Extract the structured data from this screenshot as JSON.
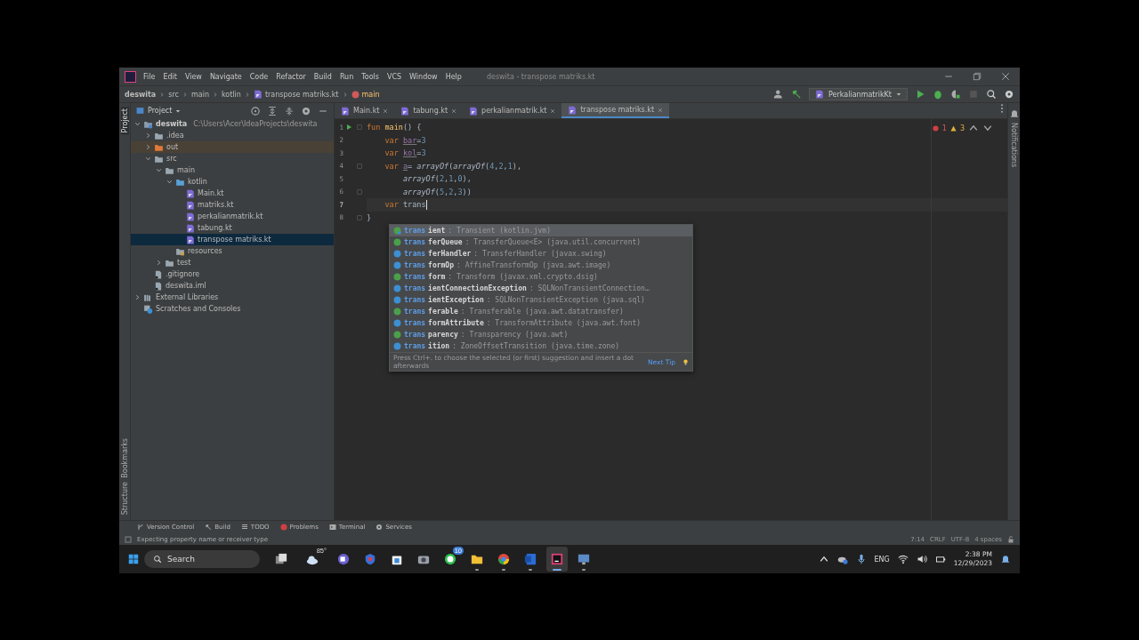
{
  "window": {
    "title": "deswita - transpose matriks.kt",
    "menu": [
      "File",
      "Edit",
      "View",
      "Navigate",
      "Code",
      "Refactor",
      "Build",
      "Run",
      "Tools",
      "VCS",
      "Window",
      "Help"
    ]
  },
  "breadcrumbs": [
    {
      "label": "deswita",
      "kind": "project"
    },
    {
      "label": "src",
      "kind": "plain"
    },
    {
      "label": "main",
      "kind": "plain"
    },
    {
      "label": "kotlin",
      "kind": "plain"
    },
    {
      "label": "transpose matriks.kt",
      "kind": "file"
    },
    {
      "label": "main",
      "kind": "function"
    }
  ],
  "run_config": {
    "label": "PerkalianmatrikKt"
  },
  "side_strip": {
    "top": [
      {
        "label": "Project",
        "selected": true
      }
    ],
    "bottom": [
      {
        "label": "Bookmarks",
        "selected": false
      },
      {
        "label": "Structure",
        "selected": false
      }
    ],
    "right": [
      {
        "label": "Notifications",
        "selected": false
      }
    ]
  },
  "project_panel": {
    "title": "Project",
    "tree": [
      {
        "label": "deswita",
        "kind": "module",
        "hint": "C:\\Users\\Acer\\IdeaProjects\\deswita",
        "expanded": true,
        "selected": false,
        "children": [
          {
            "label": ".idea",
            "kind": "folder",
            "expanded": false,
            "selected": false
          },
          {
            "label": "out",
            "kind": "excluded",
            "expanded": false,
            "selected": false
          },
          {
            "label": "src",
            "kind": "folder",
            "expanded": true,
            "selected": false,
            "children": [
              {
                "label": "main",
                "kind": "folder",
                "expanded": true,
                "selected": false,
                "children": [
                  {
                    "label": "kotlin",
                    "kind": "source",
                    "expanded": true,
                    "selected": false,
                    "children": [
                      {
                        "label": "Main.kt",
                        "kind": "kotlin",
                        "selected": false
                      },
                      {
                        "label": "matriks.kt",
                        "kind": "kotlin",
                        "selected": false
                      },
                      {
                        "label": "perkalianmatrik.kt",
                        "kind": "kotlin",
                        "selected": false
                      },
                      {
                        "label": "tabung.kt",
                        "kind": "kotlin",
                        "selected": false
                      },
                      {
                        "label": "transpose matriks.kt",
                        "kind": "kotlin",
                        "selected": true
                      }
                    ]
                  },
                  {
                    "label": "resources",
                    "kind": "resources",
                    "selected": false
                  }
                ]
              },
              {
                "label": "test",
                "kind": "folder",
                "expanded": false,
                "selected": false
              }
            ]
          },
          {
            "label": ".gitignore",
            "kind": "textfile",
            "selected": false
          },
          {
            "label": "deswita.iml",
            "kind": "textfile",
            "selected": false
          }
        ]
      },
      {
        "label": "External Libraries",
        "kind": "libraries",
        "expanded": false,
        "selected": false
      },
      {
        "label": "Scratches and Consoles",
        "kind": "scratches",
        "selected": false
      }
    ]
  },
  "tabs": [
    {
      "label": "Main.kt",
      "selected": false
    },
    {
      "label": "tabung.kt",
      "selected": false
    },
    {
      "label": "perkalianmatrik.kt",
      "selected": false
    },
    {
      "label": "transpose matriks.kt",
      "selected": true
    }
  ],
  "editor": {
    "inspections": {
      "errors": "1",
      "warnings": "3"
    },
    "lines": [
      {
        "number": "1",
        "run": true,
        "fold": true,
        "current": false,
        "tokens": [
          {
            "kind": "keyword",
            "text": "fun "
          },
          {
            "kind": "function",
            "text": "main"
          },
          {
            "kind": "plain",
            "text": "() {"
          }
        ]
      },
      {
        "number": "2",
        "run": false,
        "fold": false,
        "current": false,
        "tokens": [
          {
            "kind": "keyword",
            "text": "    var "
          },
          {
            "kind": "unused",
            "text": "bar"
          },
          {
            "kind": "plain",
            "text": "="
          },
          {
            "kind": "number",
            "text": "3"
          }
        ]
      },
      {
        "number": "3",
        "run": false,
        "fold": false,
        "current": false,
        "tokens": [
          {
            "kind": "keyword",
            "text": "    var "
          },
          {
            "kind": "unused",
            "text": "kol"
          },
          {
            "kind": "plain",
            "text": "="
          },
          {
            "kind": "number",
            "text": "3"
          }
        ]
      },
      {
        "number": "4",
        "run": false,
        "fold": true,
        "current": false,
        "tokens": [
          {
            "kind": "keyword",
            "text": "    var "
          },
          {
            "kind": "unused",
            "text": "a"
          },
          {
            "kind": "plain",
            "text": "= "
          },
          {
            "kind": "call",
            "text": "arrayOf"
          },
          {
            "kind": "plain",
            "text": "("
          },
          {
            "kind": "call",
            "text": "arrayOf"
          },
          {
            "kind": "plain",
            "text": "("
          },
          {
            "kind": "number",
            "text": "4"
          },
          {
            "kind": "plain",
            "text": ","
          },
          {
            "kind": "number",
            "text": "2"
          },
          {
            "kind": "plain",
            "text": ","
          },
          {
            "kind": "number",
            "text": "1"
          },
          {
            "kind": "plain",
            "text": "),"
          }
        ]
      },
      {
        "number": "5",
        "run": false,
        "fold": false,
        "current": false,
        "tokens": [
          {
            "kind": "call",
            "text": "        arrayOf"
          },
          {
            "kind": "plain",
            "text": "("
          },
          {
            "kind": "number",
            "text": "2"
          },
          {
            "kind": "plain",
            "text": ","
          },
          {
            "kind": "number",
            "text": "1"
          },
          {
            "kind": "plain",
            "text": ","
          },
          {
            "kind": "number",
            "text": "0"
          },
          {
            "kind": "plain",
            "text": "),"
          }
        ]
      },
      {
        "number": "6",
        "run": false,
        "fold": true,
        "current": false,
        "tokens": [
          {
            "kind": "call",
            "text": "        arrayOf"
          },
          {
            "kind": "plain",
            "text": "("
          },
          {
            "kind": "number",
            "text": "5"
          },
          {
            "kind": "plain",
            "text": ","
          },
          {
            "kind": "number",
            "text": "2"
          },
          {
            "kind": "plain",
            "text": ","
          },
          {
            "kind": "number",
            "text": "3"
          },
          {
            "kind": "plain",
            "text": "))"
          }
        ]
      },
      {
        "number": "7",
        "run": false,
        "fold": false,
        "current": true,
        "tokens": [
          {
            "kind": "keyword",
            "text": "    var "
          },
          {
            "kind": "plain",
            "text": "trans"
          }
        ]
      },
      {
        "number": "8",
        "run": false,
        "fold": true,
        "current": false,
        "tokens": [
          {
            "kind": "plain",
            "text": "}"
          }
        ]
      }
    ]
  },
  "completion": {
    "hint": "Press Ctrl+. to choose the selected (or first) suggestion and insert a dot afterwards",
    "link": "Next Tip",
    "items": [
      {
        "kind": "property",
        "match": "trans",
        "rest": "ient",
        "type": ": Transient (kotlin.jvm)",
        "selected": true
      },
      {
        "kind": "interface",
        "match": "trans",
        "rest": "ferQueue",
        "type": ": TransferQueue<E> (java.util.concurrent)",
        "selected": false
      },
      {
        "kind": "class",
        "match": "trans",
        "rest": "ferHandler",
        "type": ": TransferHandler (javax.swing)",
        "selected": false
      },
      {
        "kind": "class",
        "match": "trans",
        "rest": "formOp",
        "type": ": AffineTransformOp (java.awt.image)",
        "selected": false
      },
      {
        "kind": "interface",
        "match": "trans",
        "rest": "form",
        "type": ": Transform (javax.xml.crypto.dsig)",
        "selected": false
      },
      {
        "kind": "class",
        "match": "trans",
        "rest": "ientConnectionException",
        "type": ": SQLNonTransientConnection…",
        "selected": false
      },
      {
        "kind": "class",
        "match": "trans",
        "rest": "ientException",
        "type": ": SQLNonTransientException (java.sql)",
        "selected": false
      },
      {
        "kind": "interface",
        "match": "trans",
        "rest": "ferable",
        "type": ": Transferable (java.awt.datatransfer)",
        "selected": false
      },
      {
        "kind": "class",
        "match": "trans",
        "rest": "formAttribute",
        "type": ": TransformAttribute (java.awt.font)",
        "selected": false
      },
      {
        "kind": "interface",
        "match": "trans",
        "rest": "parency",
        "type": ": Transparency (java.awt)",
        "selected": false
      },
      {
        "kind": "class",
        "match": "trans",
        "rest": "ition",
        "type": ": ZoneOffsetTransition (java.time.zone)",
        "selected": false
      }
    ]
  },
  "tool_windows": [
    {
      "label": "Version Control",
      "kind": "branch"
    },
    {
      "label": "Build",
      "kind": "hammer"
    },
    {
      "label": "TODO",
      "kind": "list"
    },
    {
      "label": "Problems",
      "kind": "problem"
    },
    {
      "label": "Terminal",
      "kind": "terminal"
    },
    {
      "label": "Services",
      "kind": "services"
    }
  ],
  "status_bar": {
    "message": "Expecting property name or receiver type",
    "items": [
      "7:14",
      "CRLF",
      "UTF-8",
      "4 spaces"
    ]
  },
  "taskbar": {
    "search": {
      "placeholder": "Search"
    },
    "apps": [
      {
        "kind": "taskview",
        "running": false,
        "selected": false
      },
      {
        "kind": "weather",
        "label": "85°",
        "running": false,
        "selected": false
      },
      {
        "kind": "chat",
        "running": false,
        "selected": false
      },
      {
        "kind": "shield",
        "running": false,
        "selected": false
      },
      {
        "kind": "store",
        "running": false,
        "selected": false
      },
      {
        "kind": "camera",
        "running": false,
        "selected": false
      },
      {
        "kind": "whatsapp",
        "badge": "10",
        "running": false,
        "selected": false
      },
      {
        "kind": "explorer",
        "running": true,
        "selected": false
      },
      {
        "kind": "chrome",
        "running": true,
        "selected": false
      },
      {
        "kind": "word",
        "running": true,
        "selected": false
      },
      {
        "kind": "intellij",
        "running": true,
        "selected": true
      },
      {
        "kind": "remote",
        "running": true,
        "selected": false
      }
    ],
    "language": "ENG",
    "time": "2:38 PM",
    "date": "12/29/2023"
  }
}
